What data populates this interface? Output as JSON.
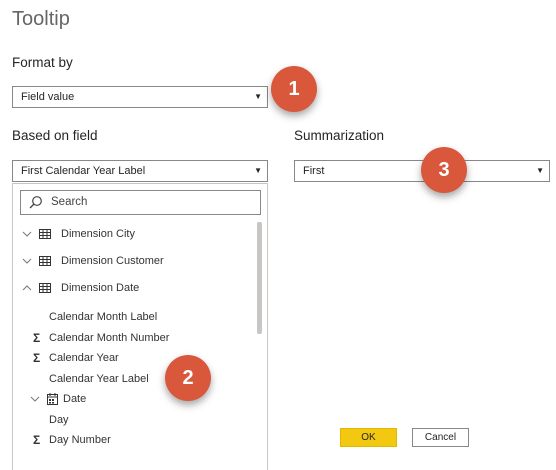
{
  "dialog": {
    "title": "Tooltip"
  },
  "format_by": {
    "label": "Format by",
    "value": "Field value"
  },
  "based_on": {
    "label": "Based on field",
    "value": "First Calendar Year Label"
  },
  "summarization": {
    "label": "Summarization",
    "value": "First"
  },
  "search": {
    "placeholder": "Search"
  },
  "fields": [
    {
      "label": "Dimension City",
      "kind": "table",
      "expanded": false
    },
    {
      "label": "Dimension Customer",
      "kind": "table",
      "expanded": false
    },
    {
      "label": "Dimension Date",
      "kind": "table",
      "expanded": true
    },
    {
      "label": "Calendar Month Label",
      "kind": "text"
    },
    {
      "label": "Calendar Month Number",
      "kind": "sum"
    },
    {
      "label": "Calendar Year",
      "kind": "sum"
    },
    {
      "label": "Calendar Year Label",
      "kind": "text"
    },
    {
      "label": "Date",
      "kind": "date",
      "expanded": true
    },
    {
      "label": "Day",
      "kind": "text"
    },
    {
      "label": "Day Number",
      "kind": "sum"
    }
  ],
  "callouts": {
    "one": "1",
    "two": "2",
    "three": "3"
  },
  "buttons": {
    "ok": "OK",
    "cancel": "Cancel"
  },
  "colors": {
    "callout": "#d9583b",
    "ok_button": "#f2c811",
    "border": "#8a8886"
  },
  "icons": [
    "search-icon",
    "chevron-down-icon",
    "chevron-up-icon",
    "table-icon",
    "sigma-icon",
    "calendar-icon",
    "caret-down-icon"
  ]
}
